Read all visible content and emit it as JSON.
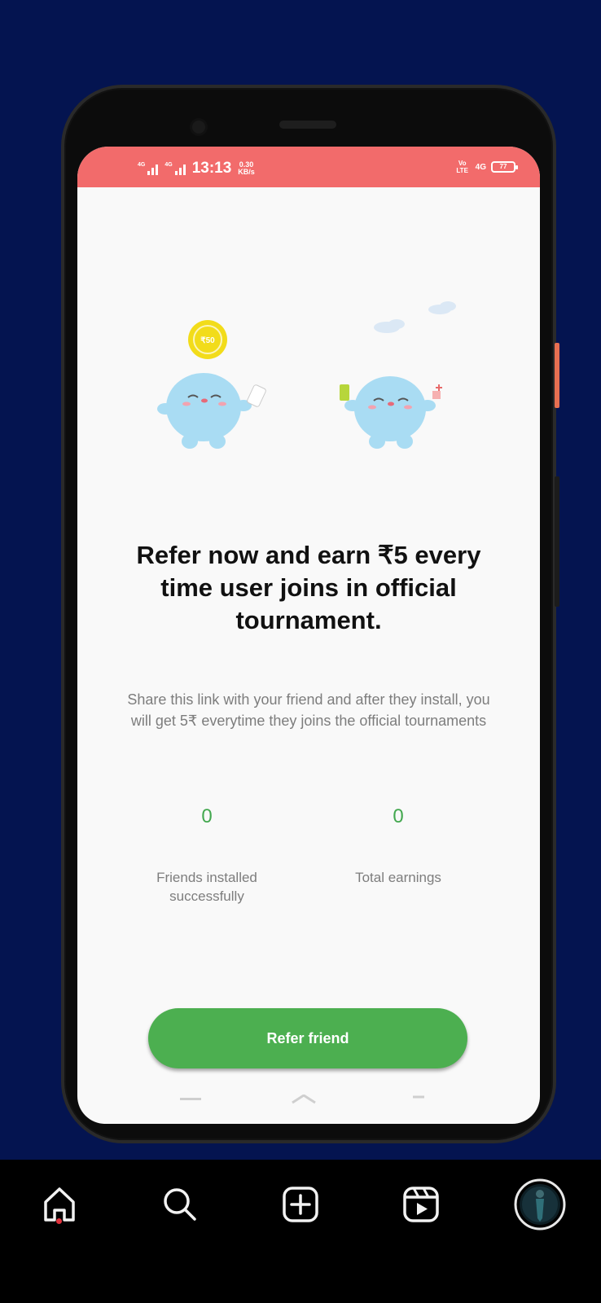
{
  "status_bar": {
    "time": "13:13",
    "speed_value": "0.30",
    "speed_unit": "KB/s",
    "sig1_tag": "4G",
    "sig2_tag": "4G",
    "volte": "Vo LTE",
    "net_right": "4G",
    "battery": "77"
  },
  "illustration": {
    "coin_label": "₹50"
  },
  "headline": "Refer now and earn ₹5 every time user joins in official tournament.",
  "subtext": "Share this link with your friend and after they install, you will get 5₹ everytime they joins the official tournaments",
  "stats": {
    "friends_installed_value": "0",
    "friends_installed_label": "Friends installed successfully",
    "total_earnings_value": "0",
    "total_earnings_label": "Total earnings"
  },
  "refer_button": "Refer friend",
  "colors": {
    "background": "#041450",
    "status_bar": "#f26b6b",
    "accent_green": "#4caf50",
    "stat_green": "#43a84f",
    "home_dot": "#e0323c"
  },
  "bottom_nav": [
    {
      "icon": "home-icon"
    },
    {
      "icon": "search-icon"
    },
    {
      "icon": "add-post-icon"
    },
    {
      "icon": "reels-icon"
    },
    {
      "icon": "profile-avatar"
    }
  ]
}
